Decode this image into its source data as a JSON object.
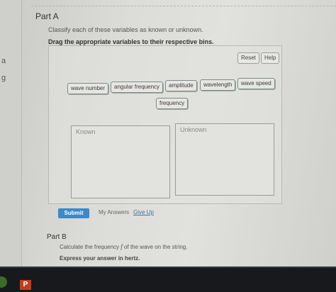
{
  "left_strip": {
    "fragment_1": "a",
    "fragment_2": "g"
  },
  "part_a": {
    "title": "Part A",
    "instruction": "Classify each of these variables as known or unknown.",
    "drag_instruction": "Drag the appropriate variables to their respective bins."
  },
  "toolbar": {
    "reset_label": "Reset",
    "help_label": "Help"
  },
  "tokens": {
    "wave_number": "wave number",
    "angular_frequency": "angular frequency",
    "amplitude": "amplitude",
    "wavelength": "wavelength",
    "wave_speed": "wave speed",
    "frequency": "frequency"
  },
  "bins": {
    "known_label": "Known",
    "unknown_label": "Unknown"
  },
  "actions": {
    "submit_label": "Submit",
    "my_answers_label": "My Answers",
    "give_up_label": "Give Up"
  },
  "part_b": {
    "title": "Part B",
    "question_prefix": "Calculate the frequency",
    "question_variable": "f",
    "question_suffix": "of the wave on the string.",
    "express": "Express your answer in hertz."
  },
  "taskbar": {
    "app_icon_label": "P"
  },
  "colors": {
    "submit": "#3b89c9",
    "link": "#3f6fa8",
    "taskbar": "#17191c",
    "powerpoint": "#c43e1c"
  }
}
